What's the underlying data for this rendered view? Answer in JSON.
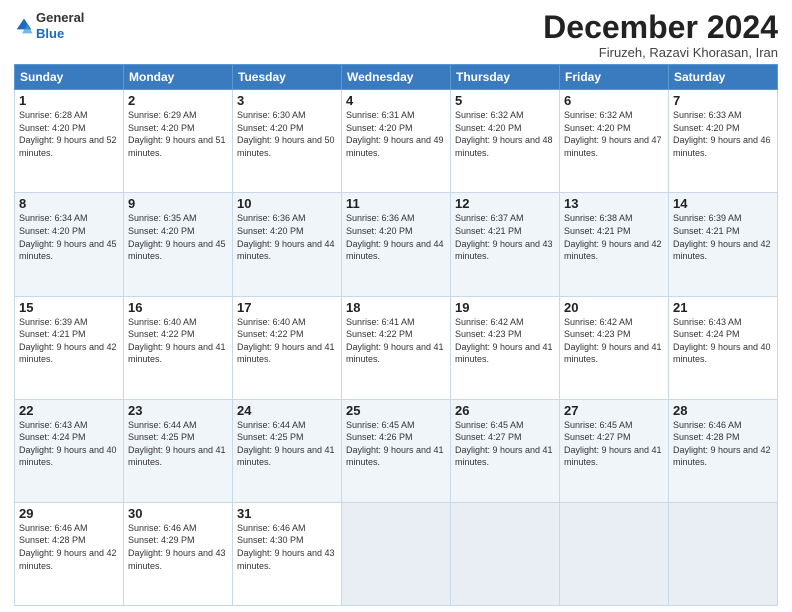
{
  "logo": {
    "general": "General",
    "blue": "Blue"
  },
  "header": {
    "title": "December 2024",
    "subtitle": "Firuzeh, Razavi Khorasan, Iran"
  },
  "weekdays": [
    "Sunday",
    "Monday",
    "Tuesday",
    "Wednesday",
    "Thursday",
    "Friday",
    "Saturday"
  ],
  "weeks": [
    [
      {
        "day": "1",
        "sunrise": "6:28 AM",
        "sunset": "4:20 PM",
        "daylight": "9 hours and 52 minutes."
      },
      {
        "day": "2",
        "sunrise": "6:29 AM",
        "sunset": "4:20 PM",
        "daylight": "9 hours and 51 minutes."
      },
      {
        "day": "3",
        "sunrise": "6:30 AM",
        "sunset": "4:20 PM",
        "daylight": "9 hours and 50 minutes."
      },
      {
        "day": "4",
        "sunrise": "6:31 AM",
        "sunset": "4:20 PM",
        "daylight": "9 hours and 49 minutes."
      },
      {
        "day": "5",
        "sunrise": "6:32 AM",
        "sunset": "4:20 PM",
        "daylight": "9 hours and 48 minutes."
      },
      {
        "day": "6",
        "sunrise": "6:32 AM",
        "sunset": "4:20 PM",
        "daylight": "9 hours and 47 minutes."
      },
      {
        "day": "7",
        "sunrise": "6:33 AM",
        "sunset": "4:20 PM",
        "daylight": "9 hours and 46 minutes."
      }
    ],
    [
      {
        "day": "8",
        "sunrise": "6:34 AM",
        "sunset": "4:20 PM",
        "daylight": "9 hours and 45 minutes."
      },
      {
        "day": "9",
        "sunrise": "6:35 AM",
        "sunset": "4:20 PM",
        "daylight": "9 hours and 45 minutes."
      },
      {
        "day": "10",
        "sunrise": "6:36 AM",
        "sunset": "4:20 PM",
        "daylight": "9 hours and 44 minutes."
      },
      {
        "day": "11",
        "sunrise": "6:36 AM",
        "sunset": "4:20 PM",
        "daylight": "9 hours and 44 minutes."
      },
      {
        "day": "12",
        "sunrise": "6:37 AM",
        "sunset": "4:21 PM",
        "daylight": "9 hours and 43 minutes."
      },
      {
        "day": "13",
        "sunrise": "6:38 AM",
        "sunset": "4:21 PM",
        "daylight": "9 hours and 42 minutes."
      },
      {
        "day": "14",
        "sunrise": "6:39 AM",
        "sunset": "4:21 PM",
        "daylight": "9 hours and 42 minutes."
      }
    ],
    [
      {
        "day": "15",
        "sunrise": "6:39 AM",
        "sunset": "4:21 PM",
        "daylight": "9 hours and 42 minutes."
      },
      {
        "day": "16",
        "sunrise": "6:40 AM",
        "sunset": "4:22 PM",
        "daylight": "9 hours and 41 minutes."
      },
      {
        "day": "17",
        "sunrise": "6:40 AM",
        "sunset": "4:22 PM",
        "daylight": "9 hours and 41 minutes."
      },
      {
        "day": "18",
        "sunrise": "6:41 AM",
        "sunset": "4:22 PM",
        "daylight": "9 hours and 41 minutes."
      },
      {
        "day": "19",
        "sunrise": "6:42 AM",
        "sunset": "4:23 PM",
        "daylight": "9 hours and 41 minutes."
      },
      {
        "day": "20",
        "sunrise": "6:42 AM",
        "sunset": "4:23 PM",
        "daylight": "9 hours and 41 minutes."
      },
      {
        "day": "21",
        "sunrise": "6:43 AM",
        "sunset": "4:24 PM",
        "daylight": "9 hours and 40 minutes."
      }
    ],
    [
      {
        "day": "22",
        "sunrise": "6:43 AM",
        "sunset": "4:24 PM",
        "daylight": "9 hours and 40 minutes."
      },
      {
        "day": "23",
        "sunrise": "6:44 AM",
        "sunset": "4:25 PM",
        "daylight": "9 hours and 41 minutes."
      },
      {
        "day": "24",
        "sunrise": "6:44 AM",
        "sunset": "4:25 PM",
        "daylight": "9 hours and 41 minutes."
      },
      {
        "day": "25",
        "sunrise": "6:45 AM",
        "sunset": "4:26 PM",
        "daylight": "9 hours and 41 minutes."
      },
      {
        "day": "26",
        "sunrise": "6:45 AM",
        "sunset": "4:27 PM",
        "daylight": "9 hours and 41 minutes."
      },
      {
        "day": "27",
        "sunrise": "6:45 AM",
        "sunset": "4:27 PM",
        "daylight": "9 hours and 41 minutes."
      },
      {
        "day": "28",
        "sunrise": "6:46 AM",
        "sunset": "4:28 PM",
        "daylight": "9 hours and 42 minutes."
      }
    ],
    [
      {
        "day": "29",
        "sunrise": "6:46 AM",
        "sunset": "4:28 PM",
        "daylight": "9 hours and 42 minutes."
      },
      {
        "day": "30",
        "sunrise": "6:46 AM",
        "sunset": "4:29 PM",
        "daylight": "9 hours and 43 minutes."
      },
      {
        "day": "31",
        "sunrise": "6:46 AM",
        "sunset": "4:30 PM",
        "daylight": "9 hours and 43 minutes."
      },
      null,
      null,
      null,
      null
    ]
  ]
}
